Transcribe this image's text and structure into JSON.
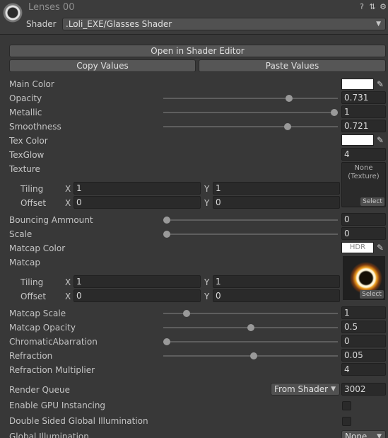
{
  "header": {
    "title": "Lenses 00",
    "shader_label": "Shader",
    "shader_value": ".Loli_EXE/Glasses Shader",
    "icons": [
      "help-icon",
      "preset-icon",
      "gear-icon"
    ]
  },
  "buttons": {
    "open_shader_editor": "Open in Shader Editor",
    "copy_values": "Copy Values",
    "paste_values": "Paste Values"
  },
  "properties": {
    "main_color": {
      "label": "Main Color",
      "color": "#ffffff"
    },
    "opacity": {
      "label": "Opacity",
      "value": "0.731",
      "slider": 0.731
    },
    "metallic": {
      "label": "Metallic",
      "value": "1",
      "slider": 1.0
    },
    "smoothness": {
      "label": "Smoothness",
      "value": "0.721",
      "slider": 0.721
    },
    "tex_color": {
      "label": "Tex Color",
      "color": "#ffffff"
    },
    "tex_glow": {
      "label": "TexGlow",
      "value": "4"
    },
    "texture": {
      "label": "Texture",
      "slot_text": "None\n(Texture)",
      "select": "Select",
      "tiling": {
        "label": "Tiling",
        "x_label": "X",
        "x": "1",
        "y_label": "Y",
        "y": "1"
      },
      "offset": {
        "label": "Offset",
        "x_label": "X",
        "x": "0",
        "y_label": "Y",
        "y": "0"
      }
    },
    "bouncing_amount": {
      "label": "Bouncing Ammount",
      "value": "0",
      "slider": 0.0
    },
    "scale": {
      "label": "Scale",
      "value": "0",
      "slider": 0.0
    },
    "matcap_color": {
      "label": "Matcap Color",
      "hdr": "HDR"
    },
    "matcap": {
      "label": "Matcap",
      "select": "Select",
      "tiling": {
        "label": "Tiling",
        "x_label": "X",
        "x": "1",
        "y_label": "Y",
        "y": "1"
      },
      "offset": {
        "label": "Offset",
        "x_label": "X",
        "x": "0",
        "y_label": "Y",
        "y": "0"
      }
    },
    "matcap_scale": {
      "label": "Matcap Scale",
      "value": "1",
      "slider": 0.12
    },
    "matcap_opacity": {
      "label": "Matcap Opacity",
      "value": "0.5",
      "slider": 0.5
    },
    "chromatic_abarration": {
      "label": "ChromaticAbarration",
      "value": "0",
      "slider": 0.0
    },
    "refraction": {
      "label": "Refraction",
      "value": "0.05",
      "slider": 0.52
    },
    "refraction_multiplier": {
      "label": "Refraction Multiplier",
      "value": "4"
    }
  },
  "footer": {
    "render_queue": {
      "label": "Render Queue",
      "mode": "From Shader",
      "value": "3002"
    },
    "gpu_instancing": {
      "label": "Enable GPU Instancing",
      "checked": false
    },
    "double_sided_gi": {
      "label": "Double Sided Global Illumination",
      "checked": false
    },
    "global_illumination": {
      "label": "Global Illumination",
      "value": "None"
    }
  },
  "colors": {
    "background": "#383838",
    "field": "#2a2a2a",
    "button": "#565656",
    "text": "#c4c4c4"
  }
}
